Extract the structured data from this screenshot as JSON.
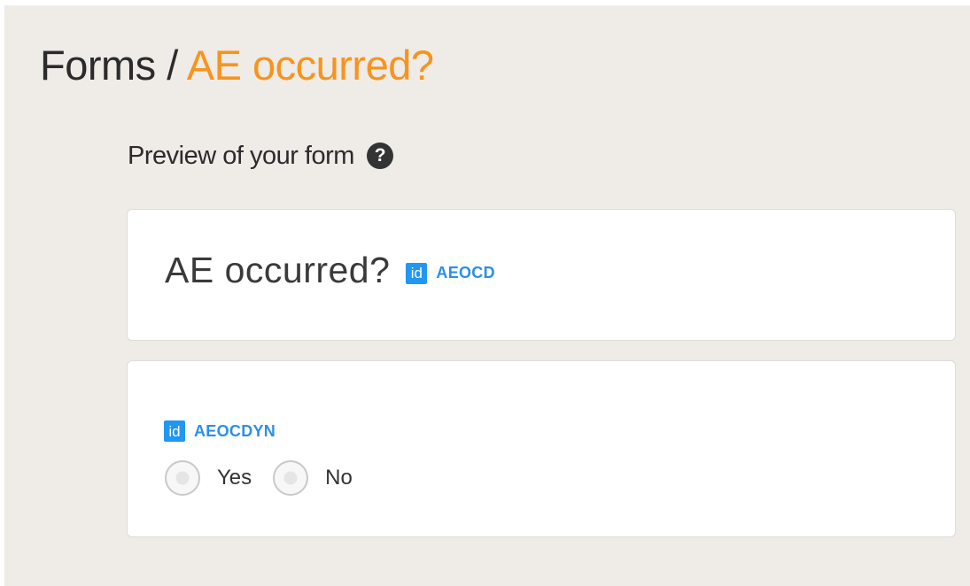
{
  "breadcrumb": {
    "root": "Forms",
    "separator": "/",
    "current": "AE occurred?"
  },
  "preview": {
    "label": "Preview of your form",
    "help_icon": "?"
  },
  "form": {
    "title": "AE occurred?",
    "id_badge": "id",
    "id_code": "AEOCD"
  },
  "field": {
    "id_badge": "id",
    "id_code": "AEOCDYN",
    "options": [
      "Yes",
      "No"
    ]
  },
  "colors": {
    "background": "#efebe7",
    "accent": "#f7941d",
    "id_blue": "#2196f3"
  }
}
